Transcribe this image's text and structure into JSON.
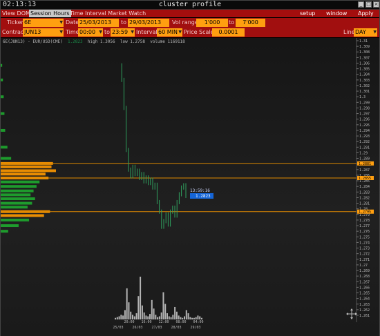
{
  "window": {
    "clock": "02:13:13",
    "title": "cluster profile",
    "buttons": [
      "minimize",
      "restore",
      "close"
    ]
  },
  "menu": {
    "left": [
      "View DOM",
      "Session Hours",
      "Time Interval Market Watch"
    ],
    "right": [
      "setup",
      "window",
      "Apply"
    ]
  },
  "params": {
    "ticker_label": "Ticker",
    "ticker": "6E",
    "date_label": "Date",
    "date_from": "25/03/2013",
    "to_label": "to",
    "date_to": "29/03/2013",
    "volrange_label": "Vol range",
    "vol_from": "1'000",
    "vol_to_label": "to",
    "vol_to": "7'000",
    "contract_label": "Contract",
    "contract": "JUN13",
    "time_label": "Time",
    "time_from": "00:00",
    "time_to_label": "to",
    "time_to": "23:59",
    "interval_label": "Interval",
    "interval": "60 MIN",
    "pricescale_label": "Price Scale",
    "pricescale": "0.0001",
    "line_label": "Line",
    "line": "DAY"
  },
  "info": {
    "symbol": "6E(JUN13) - EUR/USD(CME)",
    "last": "1.2823",
    "high": "high 1.3056",
    "low": "low 1.2758",
    "volume": "volume 1169118"
  },
  "cursor": {
    "time": "13:59:16",
    "price": "1.2823"
  },
  "price_axis": {
    "ticks": [
      "1.31",
      "1.309",
      "1.308",
      "1.307",
      "1.306",
      "1.305",
      "1.304",
      "1.303",
      "1.302",
      "1.301",
      "1.3",
      "1.299",
      "1.298",
      "1.297",
      "1.296",
      "1.295",
      "1.294",
      "1.293",
      "1.292",
      "1.291",
      "1.29",
      "1.289",
      "1.288",
      "1.287",
      "1.286",
      "1.285",
      "1.284",
      "1.283",
      "1.282",
      "1.281",
      "1.28",
      "1.279",
      "1.278",
      "1.277",
      "1.276",
      "1.275",
      "1.274",
      "1.273",
      "1.272",
      "1.271",
      "1.27",
      "1.269",
      "1.268",
      "1.267",
      "1.266",
      "1.265",
      "1.264",
      "1.263",
      "1.262",
      "1.261"
    ],
    "highlight": [
      {
        "price": "1.2881"
      },
      {
        "price": "1.2855"
      },
      {
        "price": "1.2795"
      }
    ]
  },
  "time_axis": {
    "times": [
      "20:00",
      "16:00",
      "12:00",
      "08:00",
      "04:00"
    ],
    "dates": [
      "25/03",
      "26/03",
      "27/03",
      "28/03",
      "29/03"
    ]
  },
  "colors": {
    "menubar": "#a40e0e",
    "field": "#ff9f10",
    "level_line": "#e08a00",
    "profile": "#1ea82f",
    "profile_hot": "#ff9900",
    "candle": "#2fa05e",
    "cursor_box": "#1565d8"
  },
  "chart_data": {
    "type": "line",
    "title": "6E(JUN13) - EUR/USD(CME)",
    "ylim": [
      1.261,
      1.31
    ],
    "price_series": [
      {
        "t": 0,
        "p": 1.3056
      },
      {
        "t": 2,
        "p": 1.303
      },
      {
        "t": 4,
        "p": 1.298
      },
      {
        "t": 6,
        "p": 1.2905
      },
      {
        "t": 8,
        "p": 1.287
      },
      {
        "t": 10,
        "p": 1.2858
      },
      {
        "t": 12,
        "p": 1.2875
      },
      {
        "t": 14,
        "p": 1.2862
      },
      {
        "t": 16,
        "p": 1.2868
      },
      {
        "t": 18,
        "p": 1.2855
      },
      {
        "t": 20,
        "p": 1.2862
      },
      {
        "t": 22,
        "p": 1.2849
      },
      {
        "t": 24,
        "p": 1.2856
      },
      {
        "t": 26,
        "p": 1.2846
      },
      {
        "t": 28,
        "p": 1.2852
      },
      {
        "t": 30,
        "p": 1.2838
      },
      {
        "t": 32,
        "p": 1.2843
      },
      {
        "t": 34,
        "p": 1.2812
      },
      {
        "t": 36,
        "p": 1.2795
      },
      {
        "t": 38,
        "p": 1.2768
      },
      {
        "t": 40,
        "p": 1.2778
      },
      {
        "t": 42,
        "p": 1.279
      },
      {
        "t": 44,
        "p": 1.2772
      },
      {
        "t": 46,
        "p": 1.2795
      },
      {
        "t": 48,
        "p": 1.2802
      },
      {
        "t": 50,
        "p": 1.2788
      },
      {
        "t": 52,
        "p": 1.2812
      },
      {
        "t": 54,
        "p": 1.2826
      },
      {
        "t": 56,
        "p": 1.2838
      },
      {
        "t": 58,
        "p": 1.2842
      },
      {
        "t": 60,
        "p": 1.2823
      }
    ],
    "volume_bars": [
      2,
      3,
      4,
      6,
      5,
      12,
      40,
      22,
      10,
      6,
      4,
      8,
      30,
      55,
      18,
      9,
      5,
      4,
      7,
      25,
      14,
      6,
      3,
      4,
      9,
      35,
      20,
      8,
      4,
      3,
      6,
      16,
      10,
      5,
      3,
      2,
      4,
      12,
      8,
      3,
      2,
      2,
      3,
      5,
      4,
      2
    ],
    "volume_profile": [
      {
        "p": 1.3056,
        "v": 2
      },
      {
        "p": 1.303,
        "v": 3
      },
      {
        "p": 1.3,
        "v": 4
      },
      {
        "p": 1.297,
        "v": 5
      },
      {
        "p": 1.294,
        "v": 6
      },
      {
        "p": 1.291,
        "v": 9
      },
      {
        "p": 1.289,
        "v": 14
      },
      {
        "p": 1.2881,
        "v": 70
      },
      {
        "p": 1.2875,
        "v": 68
      },
      {
        "p": 1.2868,
        "v": 74
      },
      {
        "p": 1.2862,
        "v": 60
      },
      {
        "p": 1.2855,
        "v": 64
      },
      {
        "p": 1.2848,
        "v": 52
      },
      {
        "p": 1.284,
        "v": 48
      },
      {
        "p": 1.2832,
        "v": 44
      },
      {
        "p": 1.2825,
        "v": 40
      },
      {
        "p": 1.2818,
        "v": 46
      },
      {
        "p": 1.281,
        "v": 42
      },
      {
        "p": 1.2803,
        "v": 36
      },
      {
        "p": 1.2795,
        "v": 66
      },
      {
        "p": 1.2788,
        "v": 58
      },
      {
        "p": 1.278,
        "v": 38
      },
      {
        "p": 1.277,
        "v": 24
      },
      {
        "p": 1.276,
        "v": 10
      }
    ]
  }
}
